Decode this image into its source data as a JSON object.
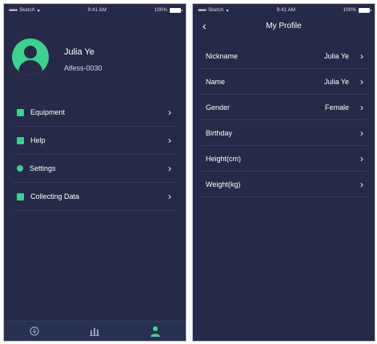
{
  "status_bar": {
    "carrier": "Sketch",
    "time": "9:41 AM",
    "battery": "100%"
  },
  "profile_menu": {
    "user_name": "Julia Ye",
    "user_id": "Alfess-0030",
    "items": [
      {
        "label": "Equipment",
        "icon": "equipment-icon"
      },
      {
        "label": "Help",
        "icon": "help-icon"
      },
      {
        "label": "Settings",
        "icon": "gear-icon"
      },
      {
        "label": "Collecting Data",
        "icon": "data-icon"
      }
    ],
    "tabs": [
      {
        "icon": "home-icon",
        "active": false
      },
      {
        "icon": "chart-icon",
        "active": false
      },
      {
        "icon": "person-icon",
        "active": true
      }
    ]
  },
  "my_profile": {
    "title": "My Profile",
    "fields": [
      {
        "label": "Nickname",
        "value": "Julia Ye"
      },
      {
        "label": "Name",
        "value": "Julia Ye"
      },
      {
        "label": "Gender",
        "value": "Female"
      },
      {
        "label": "Birthday",
        "value": ""
      },
      {
        "label": "Height(cm)",
        "value": ""
      },
      {
        "label": "Weight(kg)",
        "value": ""
      }
    ]
  },
  "colors": {
    "background": "#252a48",
    "accent": "#3fcf8e",
    "divider": "#353b5c"
  }
}
